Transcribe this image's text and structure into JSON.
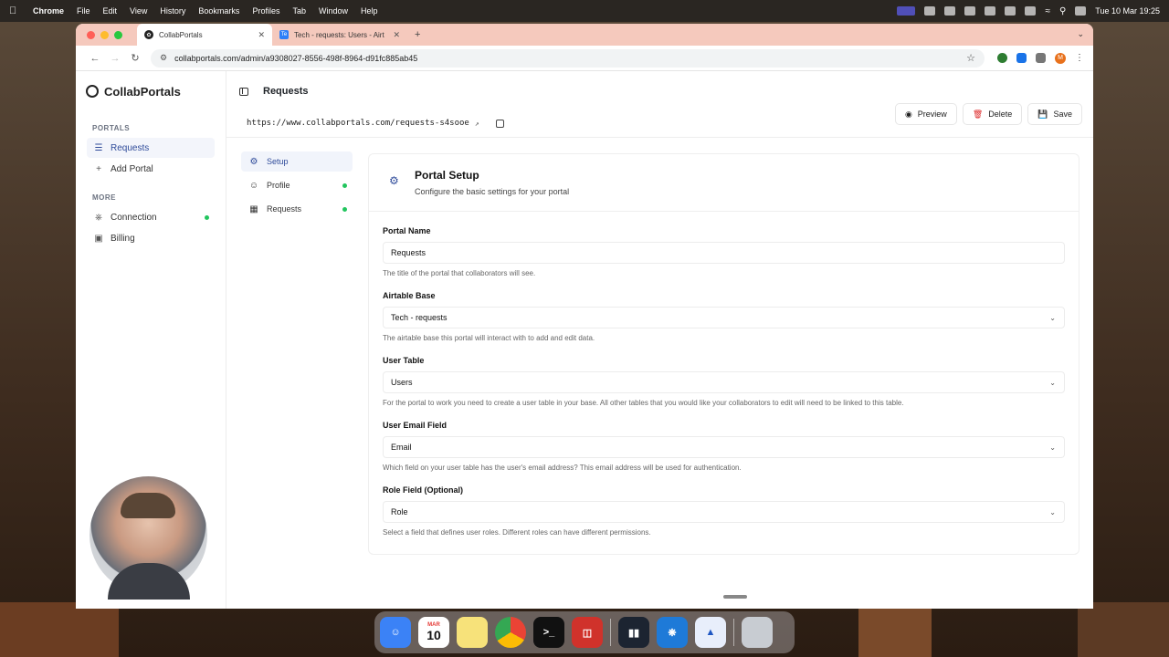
{
  "menubar": {
    "app": "Chrome",
    "items": [
      "File",
      "Edit",
      "View",
      "History",
      "Bookmarks",
      "Profiles",
      "Tab",
      "Window",
      "Help"
    ],
    "datetime": "Tue 10 Mar  19:25"
  },
  "browser": {
    "tabs": [
      {
        "title": "CollabPortals",
        "favicon": "collabportals-logo"
      },
      {
        "title": "Tech - requests: Users - Airt",
        "favicon": "airtable-logo"
      }
    ],
    "url": "collabportals.com/admin/a9308027-8556-498f-8964-d91fc885ab45",
    "profile_initial": "M"
  },
  "sidebar": {
    "brand": "CollabPortals",
    "portals_label": "PORTALS",
    "portals": [
      {
        "label": "Requests",
        "icon": "layers-icon",
        "active": true
      },
      {
        "label": "Add Portal",
        "icon": "plus-icon"
      }
    ],
    "more_label": "MORE",
    "more": [
      {
        "label": "Connection",
        "icon": "plug-icon",
        "status": "connected"
      },
      {
        "label": "Billing",
        "icon": "card-icon"
      }
    ]
  },
  "header": {
    "title": "Requests",
    "portal_url": "https://www.collabportals.com/requests-s4sooe",
    "preview_label": "Preview",
    "delete_label": "Delete",
    "save_label": "Save"
  },
  "subnav": [
    {
      "label": "Setup",
      "icon": "gear-icon",
      "active": true
    },
    {
      "label": "Profile",
      "icon": "user-circle-icon",
      "complete": true
    },
    {
      "label": "Requests",
      "icon": "table-icon",
      "complete": true
    }
  ],
  "setup": {
    "title": "Portal Setup",
    "subtitle": "Configure the basic settings for your portal",
    "fields": [
      {
        "label": "Portal Name",
        "value": "Requests",
        "type": "text",
        "hint": "The title of the portal that collaborators will see."
      },
      {
        "label": "Airtable Base",
        "value": "Tech - requests",
        "type": "select",
        "hint": "The airtable base this portal will interact with to add and edit data."
      },
      {
        "label": "User Table",
        "value": "Users",
        "type": "select",
        "hint": "For the portal to work you need to create a user table in your base. All other tables that you would like your collaborators to edit will need to be linked to this table."
      },
      {
        "label": "User Email Field",
        "value": "Email",
        "type": "select",
        "hint": "Which field on your user table has the user's email address? This email address will be used for authentication."
      },
      {
        "label": "Role Field (Optional)",
        "value": "Role",
        "type": "select",
        "hint": "Select a field that defines user roles. Different roles can have different permissions."
      }
    ]
  },
  "dock": {
    "calendar_month": "MAR",
    "calendar_day": "10"
  },
  "colors": {
    "accent": "#2f4b9a",
    "status_green": "#22c55e",
    "delete_red": "#dc2626",
    "tabbar": "#f5c9bd"
  }
}
